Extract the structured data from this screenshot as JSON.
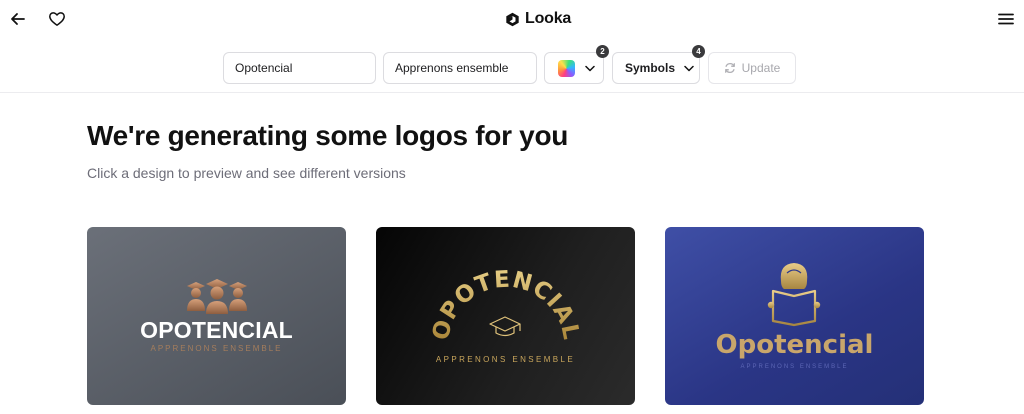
{
  "header": {
    "brand": "Looka",
    "icons": {
      "back": "arrow-left-icon",
      "favorite": "heart-icon",
      "logo": "looka-logo-icon",
      "menu": "hamburger-menu-icon"
    }
  },
  "toolbar": {
    "company_name": "Opotencial",
    "slogan": "Apprenons ensemble",
    "colors": {
      "count": "2",
      "icon": "color-palette-swatch"
    },
    "symbols": {
      "label": "Symbols",
      "count": "4"
    },
    "update_label": "Update"
  },
  "main": {
    "title": "We're generating some logos for you",
    "subtitle": "Click a design to preview and see different versions"
  },
  "logos": [
    {
      "name": "OPOTENCIAL",
      "slogan": "APPRENONS ENSEMBLE",
      "background": "#5b6069",
      "name_color": "#ffffff",
      "accent": "#b0805b",
      "icon": "three-graduates-icon"
    },
    {
      "name": "OPOTENCIAL",
      "slogan": "APPRENONS ENSEMBLE",
      "background": "#111111",
      "accent": "#c9a65c",
      "icon": "graduation-cap-icon"
    },
    {
      "name": "Opotencial",
      "slogan": "APPRENONS ENSEMBLE",
      "background": "#2f3b8e",
      "accent": "#c9a66b",
      "icon": "person-reading-book-icon"
    }
  ]
}
